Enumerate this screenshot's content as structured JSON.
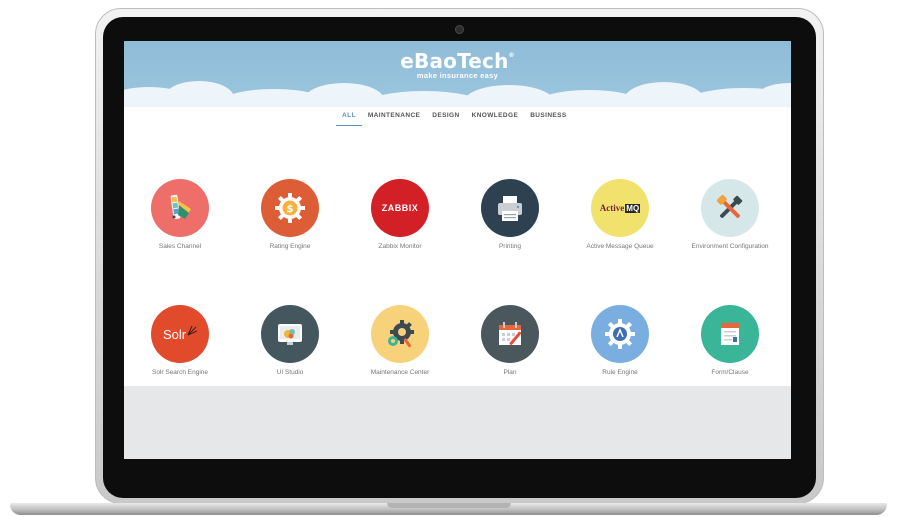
{
  "brand": {
    "logo_text": "eBaoTech",
    "registered_mark": "®",
    "tagline": "make insurance easy"
  },
  "tabs": [
    {
      "label": "ALL",
      "active": true
    },
    {
      "label": "MAINTENANCE",
      "active": false
    },
    {
      "label": "DESIGN",
      "active": false
    },
    {
      "label": "KNOWLEDGE",
      "active": false
    },
    {
      "label": "BUSINESS",
      "active": false
    }
  ],
  "apps": [
    {
      "label": "Sales Channel",
      "icon": "palette-icon",
      "color": "#ee6e6a"
    },
    {
      "label": "Rating Engine",
      "icon": "gear-dollar-icon",
      "color": "#dd5d36"
    },
    {
      "label": "Zabbix Monitor",
      "icon": "zabbix-logo",
      "icon_text": "ZABBIX",
      "color": "#d31f26"
    },
    {
      "label": "Printing",
      "icon": "printer-icon",
      "color": "#2e4150"
    },
    {
      "label": "Active Message Queue",
      "icon": "activemq-logo",
      "icon_text": "Active",
      "icon_text_2": "MQ",
      "color": "#f0e26c"
    },
    {
      "label": "Environment Configuration",
      "icon": "tools-icon",
      "color": "#d6e7ea"
    },
    {
      "label": "Solr Search Engine",
      "icon": "solr-logo",
      "icon_text": "Solr",
      "color": "#e24a2c"
    },
    {
      "label": "UI Studio",
      "icon": "monitor-icon",
      "color": "#45575e"
    },
    {
      "label": "Maintenance Center",
      "icon": "gears-icon",
      "color": "#f8d27a"
    },
    {
      "label": "Plan",
      "icon": "calendar-icon",
      "color": "#4a575c"
    },
    {
      "label": "Rule Engine",
      "icon": "gear-rule-icon",
      "color": "#7aaee0"
    },
    {
      "label": "Form/Clause",
      "icon": "document-icon",
      "color": "#3ab597"
    }
  ]
}
